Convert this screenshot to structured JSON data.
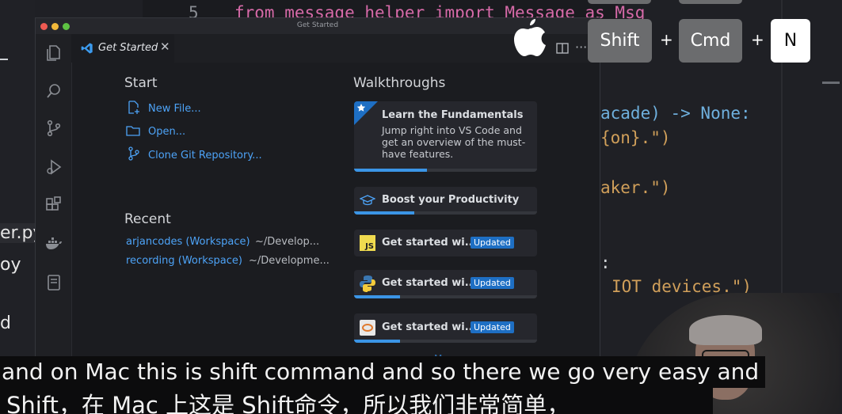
{
  "background": {
    "code_top": "from message_helper import Message as Msg",
    "line_number": "5",
    "code_right": [
      {
        "text": "acade) -> None:",
        "color": "#6fb0de"
      },
      {
        "text": "{on}.\")",
        "color": "#d09f5a"
      },
      {
        "text": "aker.\")",
        "color": "#d09f5a"
      },
      {
        "text": ":",
        "color": "#cfd2d6"
      },
      {
        "text": "IOT devices.\")",
        "color": "#d09f5a"
      }
    ],
    "left_fragments": [
      "er.py",
      "oy",
      "d"
    ]
  },
  "window": {
    "title": "Get Started",
    "tab_label": "Get Started",
    "more_label": "More..."
  },
  "start": {
    "heading": "Start",
    "items": [
      {
        "label": "New File...",
        "icon": "new-file-icon"
      },
      {
        "label": "Open...",
        "icon": "folder-icon"
      },
      {
        "label": "Clone Git Repository...",
        "icon": "git-branch-icon"
      }
    ]
  },
  "recent": {
    "heading": "Recent",
    "items": [
      {
        "name": "arjancodes (Workspace)",
        "path": "~/Develop..."
      },
      {
        "name": "recording (Workspace)",
        "path": "~/Developme..."
      }
    ]
  },
  "walkthroughs": {
    "heading": "Walkthroughs",
    "cards": [
      {
        "title": "Learn the Fundamentals",
        "desc_lines": [
          "Jump right into VS Code and",
          "get an overview of the must-",
          "have features."
        ],
        "progress": 0.4,
        "icon": "star-badge-icon"
      },
      {
        "title": "Boost your Productivity",
        "progress": 0.33,
        "icon": "graduation-cap-icon"
      },
      {
        "title": "Get started wi...",
        "badge": "Updated",
        "icon": "javascript-icon"
      },
      {
        "title": "Get started wi...",
        "badge": "Updated",
        "progress": 0.25,
        "icon": "python-icon"
      },
      {
        "title": "Get started wi...",
        "badge": "Updated",
        "progress": 0.25,
        "icon": "jupyter-icon"
      }
    ]
  },
  "keys": {
    "shift": "Shift",
    "plus": "+",
    "cmd": "Cmd",
    "n": "N"
  },
  "subtitles": {
    "en": "and on Mac this is shift command and so there we go very easy and",
    "zh": "Shift，在 Mac 上这是 Shift命令，所以我们非常简单，"
  }
}
